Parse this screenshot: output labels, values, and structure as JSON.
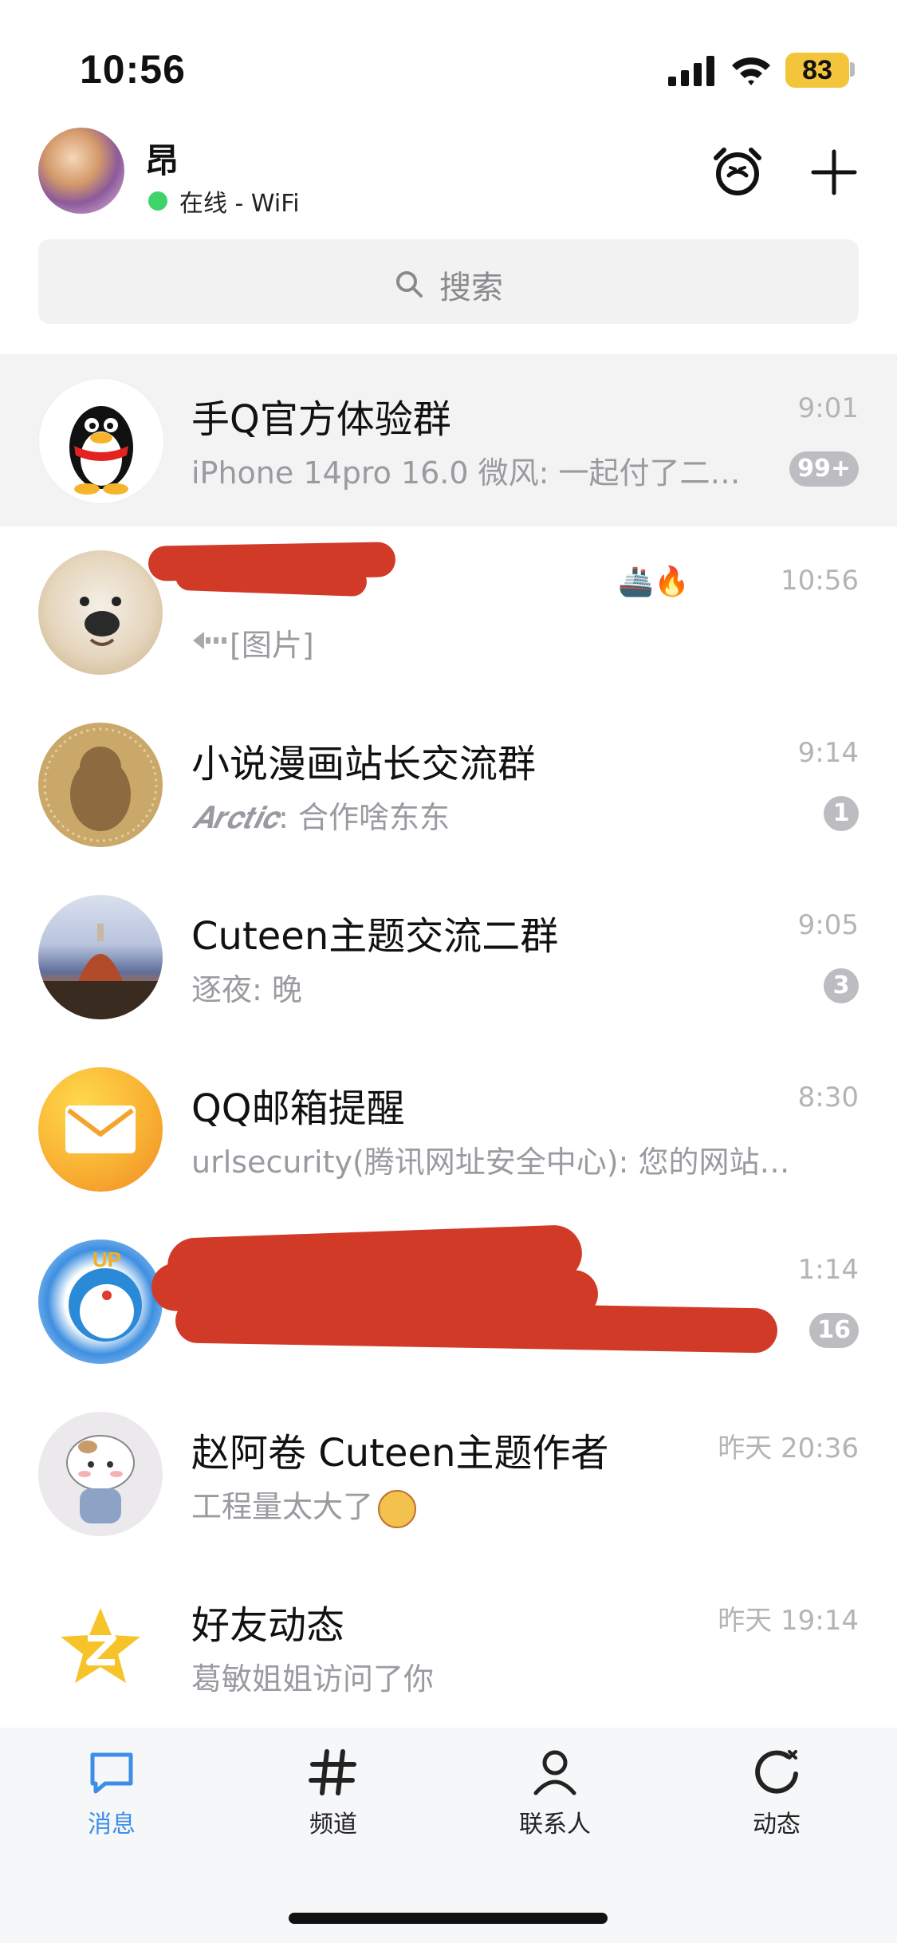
{
  "status_bar": {
    "time": "10:56",
    "battery": "83"
  },
  "header": {
    "username": "昂",
    "status": "在线 - WiFi"
  },
  "search": {
    "placeholder": "搜索"
  },
  "chats": [
    {
      "title": "手Q官方体验群",
      "preview": "iPhone 14pro 16.0 微风: 一起付了二…",
      "time": "9:01",
      "badge": "99+",
      "pinned": true
    },
    {
      "title": "",
      "preview": "[图片]",
      "time": "10:56",
      "badge": "",
      "emoji": "🚢🔥"
    },
    {
      "title": "小说漫画站长交流群",
      "preview_sender": "𝑨𝒓𝒄𝒕𝒊𝒄",
      "preview": ": 合作啥东东",
      "time": "9:14",
      "badge": "1"
    },
    {
      "title": "Cuteen主题交流二群",
      "preview": "逐夜: 晚",
      "time": "9:05",
      "badge": "3"
    },
    {
      "title": "QQ邮箱提醒",
      "preview": "urlsecurity(腾讯网址安全中心): 您的网站…",
      "time": "8:30",
      "badge": ""
    },
    {
      "title": "",
      "preview": "",
      "time": "1:14",
      "badge": "16"
    },
    {
      "title": "赵阿卷 Cuteen主题作者",
      "preview": "工程量太大了",
      "time": "昨天 20:36",
      "badge": ""
    },
    {
      "title": "好友动态",
      "preview": "葛敏姐姐访问了你",
      "time": "昨天 19:14",
      "badge": ""
    }
  ],
  "tabs": [
    {
      "label": "消息",
      "active": true
    },
    {
      "label": "频道"
    },
    {
      "label": "联系人"
    },
    {
      "label": "动态"
    }
  ],
  "colors": {
    "accent": "#3d8ee8",
    "badge": "#bdbdc1",
    "online": "#3fd36b",
    "redaction": "#d23a28"
  }
}
